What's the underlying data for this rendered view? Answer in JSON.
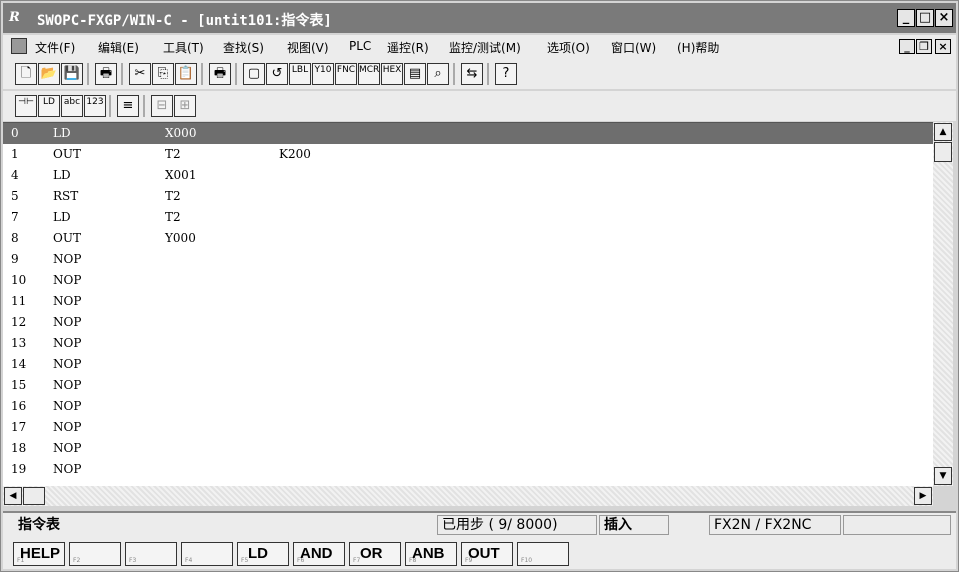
{
  "window": {
    "title": "SWOPC-FXGP/WIN-C - [untit101:指令表]",
    "app_icon": "R",
    "buttons": {
      "minimize": "_",
      "maximize": "□",
      "close": "×"
    }
  },
  "menubar": {
    "items": [
      "文件(F)",
      "编辑(E)",
      "工具(T)",
      "查找(S)",
      "视图(V)",
      "PLC",
      "遥控(R)",
      "监控/测试(M)",
      "选项(O)",
      "窗口(W)",
      "(H)帮助"
    ],
    "mdi_buttons": {
      "minimize": "_",
      "restore": "❐",
      "close": "×"
    }
  },
  "toolbar1": {
    "buttons": [
      {
        "icon": "new-file-icon",
        "glyph": "🗋"
      },
      {
        "icon": "open-file-icon",
        "glyph": "📂"
      },
      {
        "icon": "save-icon",
        "glyph": "💾"
      },
      {
        "icon": "print-icon",
        "glyph": "🖶"
      },
      {
        "icon": "cut-icon",
        "glyph": "✂"
      },
      {
        "icon": "copy-icon",
        "glyph": "⎘"
      },
      {
        "icon": "paste-icon",
        "glyph": "📋"
      },
      {
        "icon": "print-preview-icon",
        "glyph": "🖶"
      },
      {
        "icon": "page-icon",
        "glyph": "▢"
      },
      {
        "icon": "page-back-icon",
        "glyph": "↺"
      },
      {
        "icon": "label-icon",
        "glyph": "LBL"
      },
      {
        "icon": "io-icon",
        "glyph": "Y10"
      },
      {
        "icon": "fnc-icon",
        "glyph": "FNC"
      },
      {
        "icon": "mcr-icon",
        "glyph": "MCR"
      },
      {
        "icon": "hex-icon",
        "glyph": "HEX"
      },
      {
        "icon": "document-icon",
        "glyph": "▤"
      },
      {
        "icon": "binoculars-icon",
        "glyph": "⌕"
      },
      {
        "icon": "transfer-icon",
        "glyph": "⇆"
      },
      {
        "icon": "help-cursor-icon",
        "glyph": "?"
      }
    ]
  },
  "toolbar2": {
    "buttons": [
      {
        "icon": "ladder-instruction-icon",
        "glyph": "⊣⊢"
      },
      {
        "icon": "ld-or-out-icon",
        "glyph": "LD"
      },
      {
        "icon": "abc-icon",
        "glyph": "abc"
      },
      {
        "icon": "numbers-icon",
        "glyph": "123"
      },
      {
        "icon": "list-icon",
        "glyph": "≡"
      },
      {
        "icon": "ladder-view-icon",
        "glyph": "⊟"
      },
      {
        "icon": "sfc-view-icon",
        "glyph": "⊞"
      }
    ]
  },
  "instruction_list": {
    "rows": [
      {
        "step": "0",
        "op": "LD",
        "operand": "X000",
        "param": "",
        "selected": true
      },
      {
        "step": "1",
        "op": "OUT",
        "operand": "T2",
        "param": "K200"
      },
      {
        "step": "4",
        "op": "LD",
        "operand": "X001",
        "param": ""
      },
      {
        "step": "5",
        "op": "RST",
        "operand": "T2",
        "param": ""
      },
      {
        "step": "7",
        "op": "LD",
        "operand": "T2",
        "param": ""
      },
      {
        "step": "8",
        "op": "OUT",
        "operand": "Y000",
        "param": ""
      },
      {
        "step": "9",
        "op": "NOP",
        "operand": "",
        "param": ""
      },
      {
        "step": "10",
        "op": "NOP",
        "operand": "",
        "param": ""
      },
      {
        "step": "11",
        "op": "NOP",
        "operand": "",
        "param": ""
      },
      {
        "step": "12",
        "op": "NOP",
        "operand": "",
        "param": ""
      },
      {
        "step": "13",
        "op": "NOP",
        "operand": "",
        "param": ""
      },
      {
        "step": "14",
        "op": "NOP",
        "operand": "",
        "param": ""
      },
      {
        "step": "15",
        "op": "NOP",
        "operand": "",
        "param": ""
      },
      {
        "step": "16",
        "op": "NOP",
        "operand": "",
        "param": ""
      },
      {
        "step": "17",
        "op": "NOP",
        "operand": "",
        "param": ""
      },
      {
        "step": "18",
        "op": "NOP",
        "operand": "",
        "param": ""
      },
      {
        "step": "19",
        "op": "NOP",
        "operand": "",
        "param": ""
      }
    ]
  },
  "scrollbar": {
    "up": "▲",
    "down": "▼",
    "left": "◀",
    "right": "▶"
  },
  "statusbar": {
    "view": "指令表",
    "steps_used": "已用步 ( 9/ 8000)",
    "mode": "插入",
    "plc_model": "FX2N / FX2NC"
  },
  "function_keys": [
    {
      "num": "F1",
      "label": "HELP"
    },
    {
      "num": "F2",
      "label": ""
    },
    {
      "num": "F3",
      "label": ""
    },
    {
      "num": "F4",
      "label": ""
    },
    {
      "num": "F5",
      "label": "LD"
    },
    {
      "num": "F6",
      "label": "AND"
    },
    {
      "num": "F7",
      "label": "OR"
    },
    {
      "num": "F8",
      "label": "ANB"
    },
    {
      "num": "F9",
      "label": "OUT"
    },
    {
      "num": "F10",
      "label": ""
    }
  ]
}
